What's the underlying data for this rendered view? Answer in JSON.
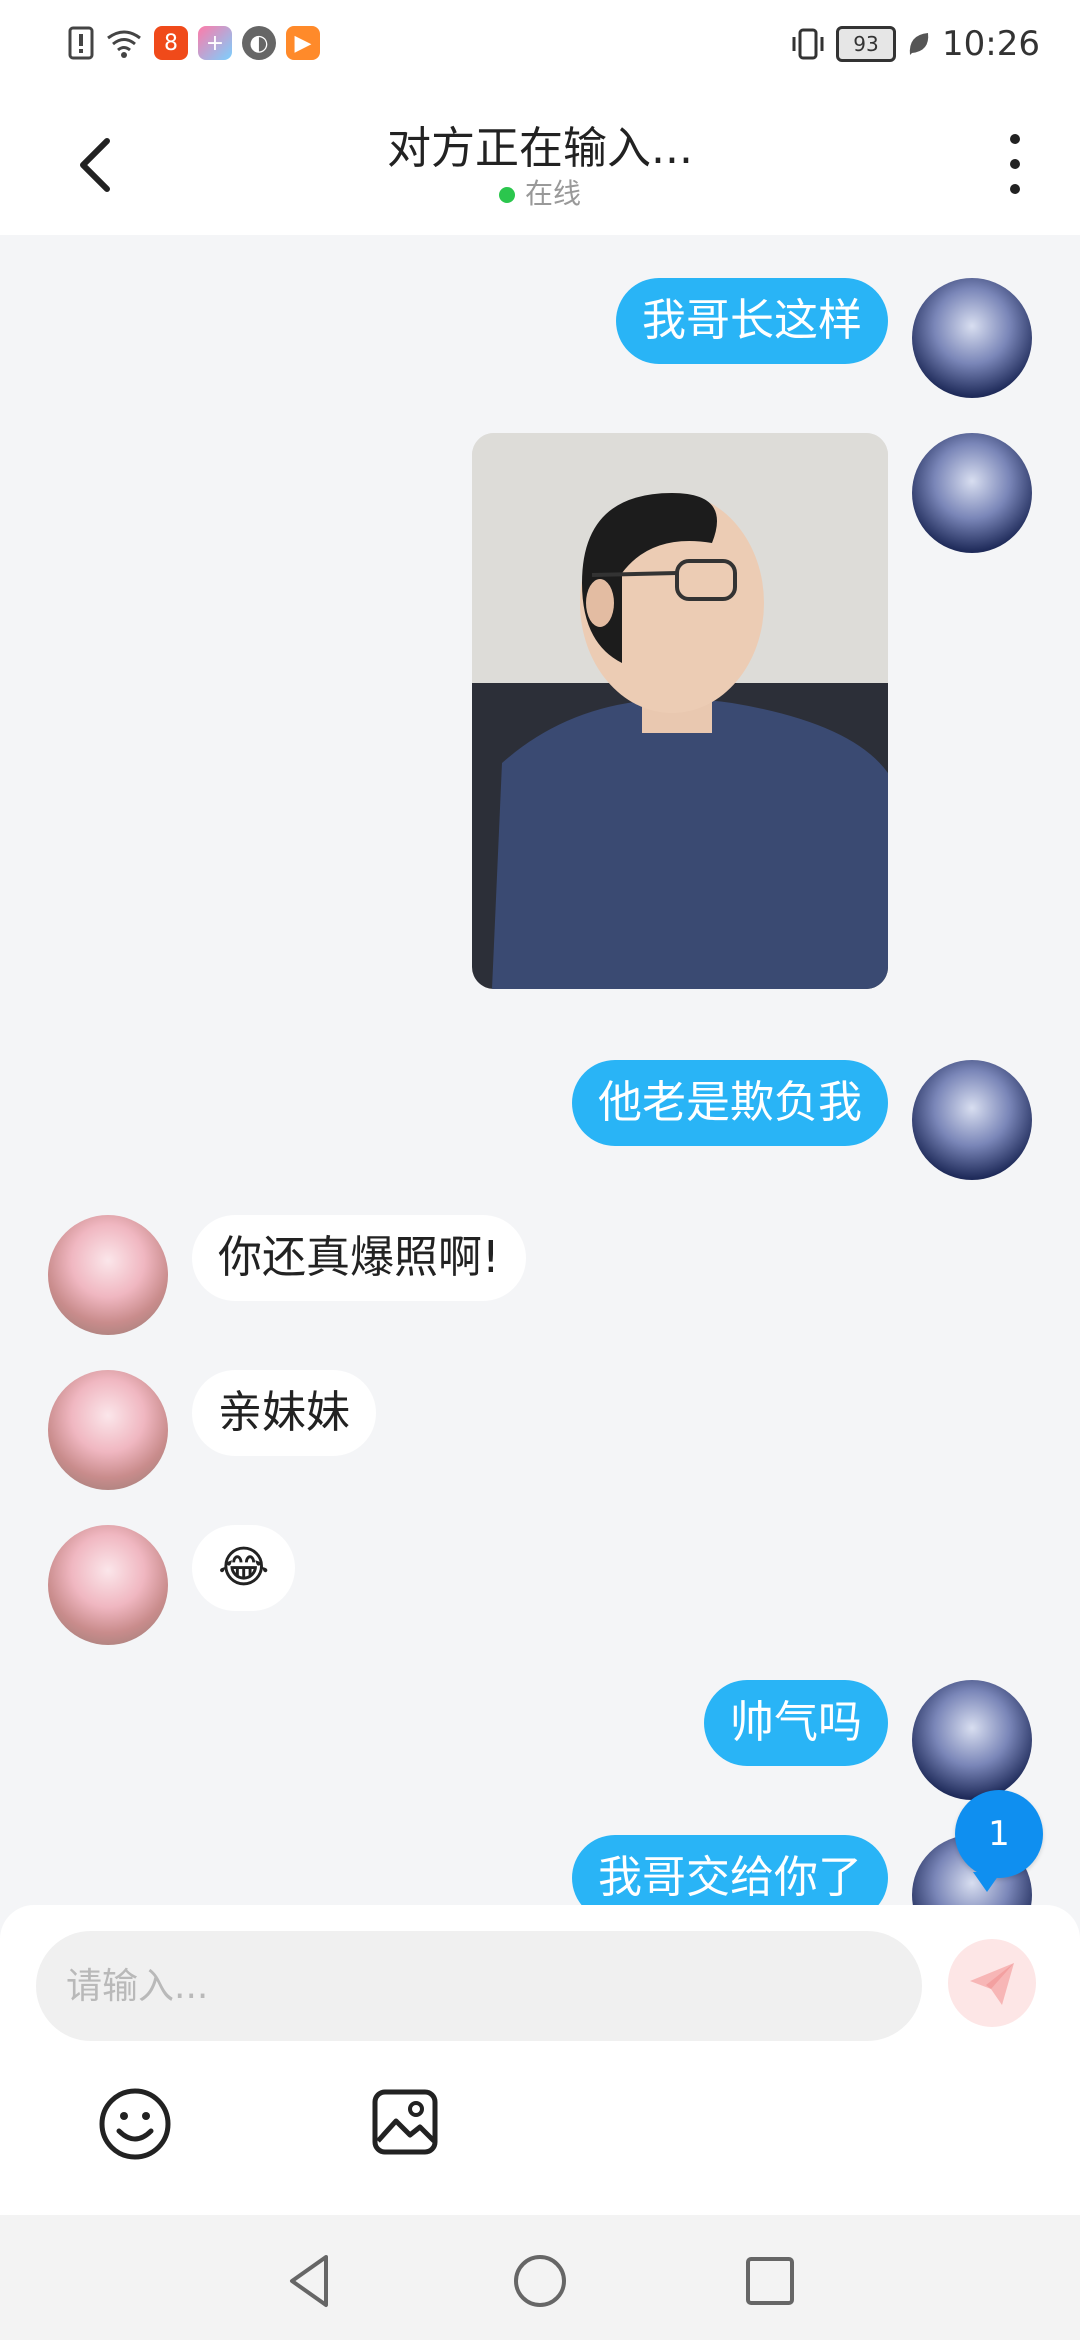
{
  "status_bar": {
    "time": "10:26",
    "battery": "93"
  },
  "header": {
    "title": "对方正在输入...",
    "status": "在线"
  },
  "messages": [
    {
      "sender": "me",
      "text": "我哥长这样"
    },
    {
      "sender": "me",
      "type": "image"
    },
    {
      "sender": "me",
      "text": "他老是欺负我"
    },
    {
      "sender": "peer",
      "text": "你还真爆照啊!"
    },
    {
      "sender": "peer",
      "text": "亲妹妹"
    },
    {
      "sender": "peer",
      "text": "😂"
    },
    {
      "sender": "me",
      "text": "帅气吗"
    },
    {
      "sender": "me",
      "text": "我哥交给你了"
    }
  ],
  "unread_badge": "1",
  "composer": {
    "placeholder": "请输入..."
  },
  "colors": {
    "outgoing_bubble": "#29b4f6",
    "incoming_bubble": "#ffffff",
    "background": "#f4f5f7",
    "online": "#2bc64d",
    "badge": "#0f8ff0"
  }
}
